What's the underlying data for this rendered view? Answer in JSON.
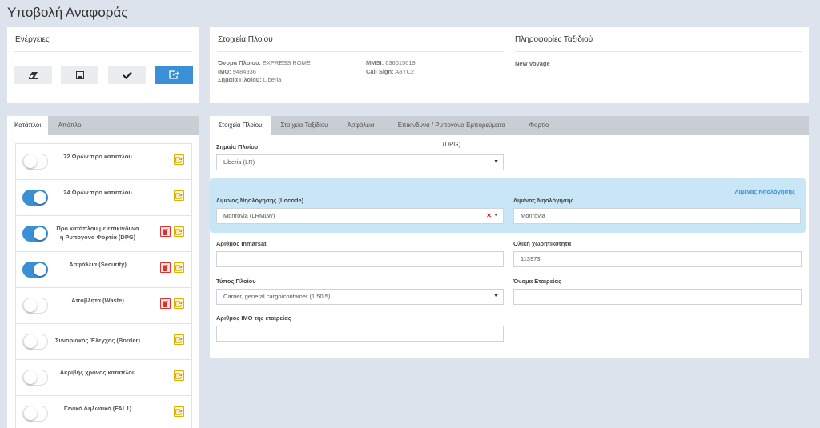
{
  "page_title": "Υποβολή Αναφοράς",
  "actions": {
    "heading": "Ενέργειες",
    "buttons": [
      {
        "name": "eraser-button",
        "icon": "eraser-icon"
      },
      {
        "name": "save-button",
        "icon": "floppy-disk-icon"
      },
      {
        "name": "check-button",
        "icon": "checkmark-icon"
      },
      {
        "name": "submit-button",
        "icon": "share-export-icon"
      }
    ]
  },
  "ship_info": {
    "heading": "Στοιχεία Πλοίου",
    "name_label": "Όνομα Πλοίου:",
    "name_value": "EXPRESS ROME",
    "imo_label": "IMO:",
    "imo_value": "9484936",
    "flag_label": "Σημαία Πλοίου:",
    "flag_value": "Liberia",
    "mmsi_label": "MMSI:",
    "mmsi_value": "636015019",
    "callsign_label": "Call Sign:",
    "callsign_value": "A8YC2"
  },
  "voyage_info": {
    "heading": "Πληροφορίες Ταξιδιού",
    "value": "New Voyage"
  },
  "left_tabs": [
    "Κατάπλοι",
    "Απόπλοι"
  ],
  "left_active_tab": 0,
  "report_rows": [
    {
      "label": "72 Ωρών προ κατάπλου",
      "on": false,
      "delete": false
    },
    {
      "label": "24 Ωρών προ κατάπλου",
      "on": true,
      "delete": false
    },
    {
      "label": "Προ κατάπλου με επικίνδυνα ή Ρυπογόνα Φορτία (DPG)",
      "on": true,
      "delete": true
    },
    {
      "label": "Ασφάλεια (Security)",
      "on": true,
      "delete": true
    },
    {
      "label": "Απόβλητα (Waste)",
      "on": false,
      "delete": true
    },
    {
      "label": "Συνοριακός Έλεγχος (Border)",
      "on": false,
      "delete": false
    },
    {
      "label": "Ακριβής χρόνος κατάπλου",
      "on": false,
      "delete": false
    },
    {
      "label": "Γενικό Δηλωτικό (FAL1)",
      "on": false,
      "delete": false
    }
  ],
  "right_tabs": [
    "Στοιχεία Πλοίου",
    "Στοιχεία Ταξιδίου",
    "Ασφάλεια",
    "Επικίνδυνα / Ρυπογόνα Εμπορεύματα (DPG)",
    "Φορτίο"
  ],
  "right_active_tab": 0,
  "form": {
    "flag_label": "Σημαία Πλοίου",
    "flag_value": "Liberia (LR)",
    "port_locode_label": "Λιμένας Νηολόγησης (Locode)",
    "port_locode_value": "Monrovia (LRMLW)",
    "port_label": "Λιμένας Νηολόγησης",
    "port_value": "Monrovia",
    "port_link": "Λιμένας Νηολόγησης",
    "inmarsat_label": "Αριθμός Inmarsat",
    "inmarsat_value": "",
    "tonnage_label": "Ολική χωρητικότητα",
    "tonnage_value": "113973",
    "ship_type_label": "Τύπος Πλοίου",
    "ship_type_value": "Carrier, general cargo/container (1.50.5)",
    "company_label": "Όνομα Εταιρείας",
    "company_value": "",
    "company_imo_label": "Αριθμός IMO της εταιρείας",
    "company_imo_value": ""
  },
  "colors": {
    "accent": "#3a8fd6",
    "toggle_on": "#3a8fd6",
    "edit_btn": "#e0b000",
    "delete_btn": "#dd3333",
    "background": "#dce3ec"
  }
}
